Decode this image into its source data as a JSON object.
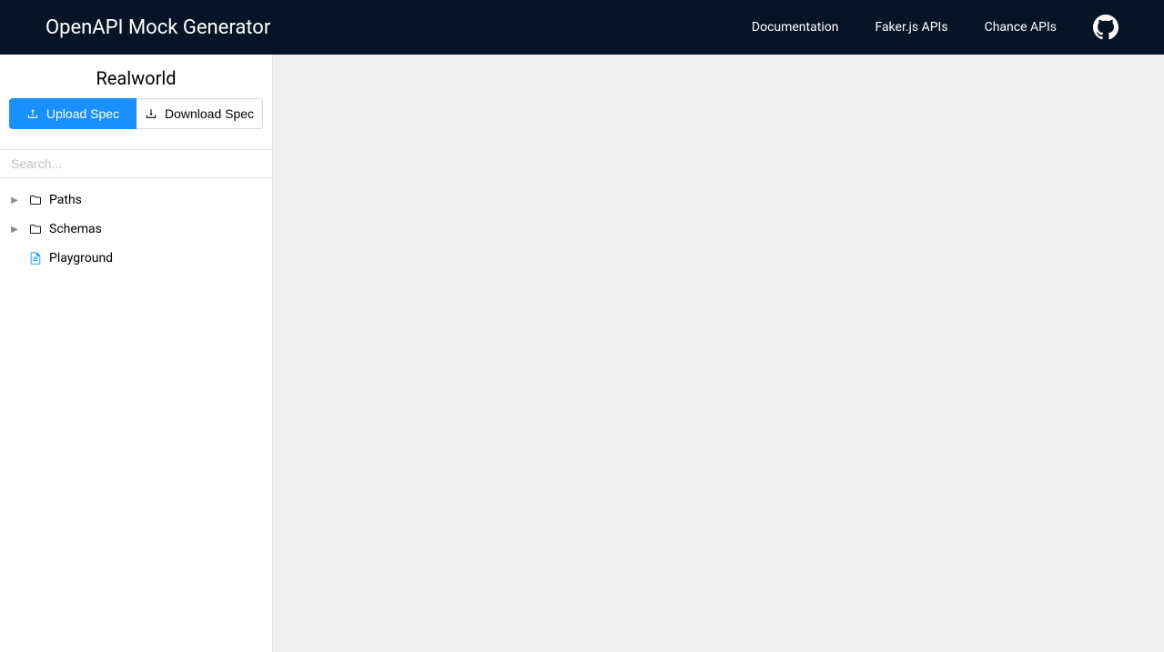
{
  "header": {
    "title": "OpenAPI Mock Generator",
    "nav": {
      "documentation": "Documentation",
      "faker": "Faker.js APIs",
      "chance": "Chance APIs"
    }
  },
  "sidebar": {
    "title": "Realworld",
    "buttons": {
      "upload": "Upload Spec",
      "download": "Download Spec"
    },
    "search": {
      "placeholder": "Search..."
    },
    "tree": {
      "paths": "Paths",
      "schemas": "Schemas",
      "playground": "Playground"
    }
  }
}
